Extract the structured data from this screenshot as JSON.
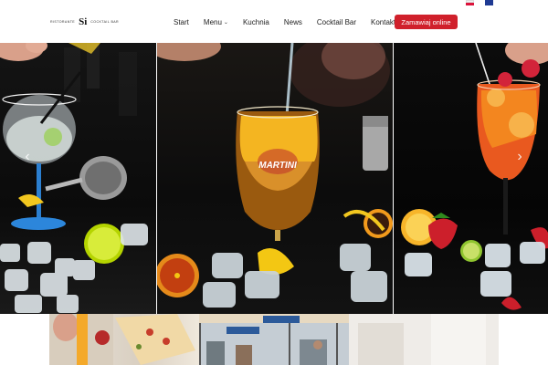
{
  "header": {
    "logo": {
      "left_text": "Ristorante",
      "mark": "Si",
      "right_text": "Cocktail Bar"
    },
    "nav": [
      {
        "label": "Start"
      },
      {
        "label": "Menu",
        "has_dropdown": true
      },
      {
        "label": "Kuchnia"
      },
      {
        "label": "News"
      },
      {
        "label": "Cocktail Bar"
      },
      {
        "label": "Kontakt"
      }
    ],
    "cta_label": "Zamawiaj online",
    "languages": [
      {
        "code": "pl",
        "icon": "poland-flag-icon"
      },
      {
        "code": "en",
        "icon": "uk-flag-icon"
      }
    ]
  },
  "hero": {
    "slides": [
      {
        "icon": "gin-tonic-glass-image"
      },
      {
        "icon": "martini-spritz-glass-image"
      },
      {
        "icon": "aperol-spritz-glass-image"
      }
    ],
    "prev_icon": "chevron-left-icon",
    "next_icon": "chevron-right-icon",
    "prev_glyph": "‹",
    "next_glyph": "›"
  },
  "gallery": [
    {
      "icon": "cocktail-and-pizza-image"
    },
    {
      "icon": "restaurant-terrace-image"
    },
    {
      "icon": "interior-image"
    }
  ],
  "colors": {
    "accent": "#d0202b",
    "text": "#222222",
    "background": "#ffffff"
  }
}
